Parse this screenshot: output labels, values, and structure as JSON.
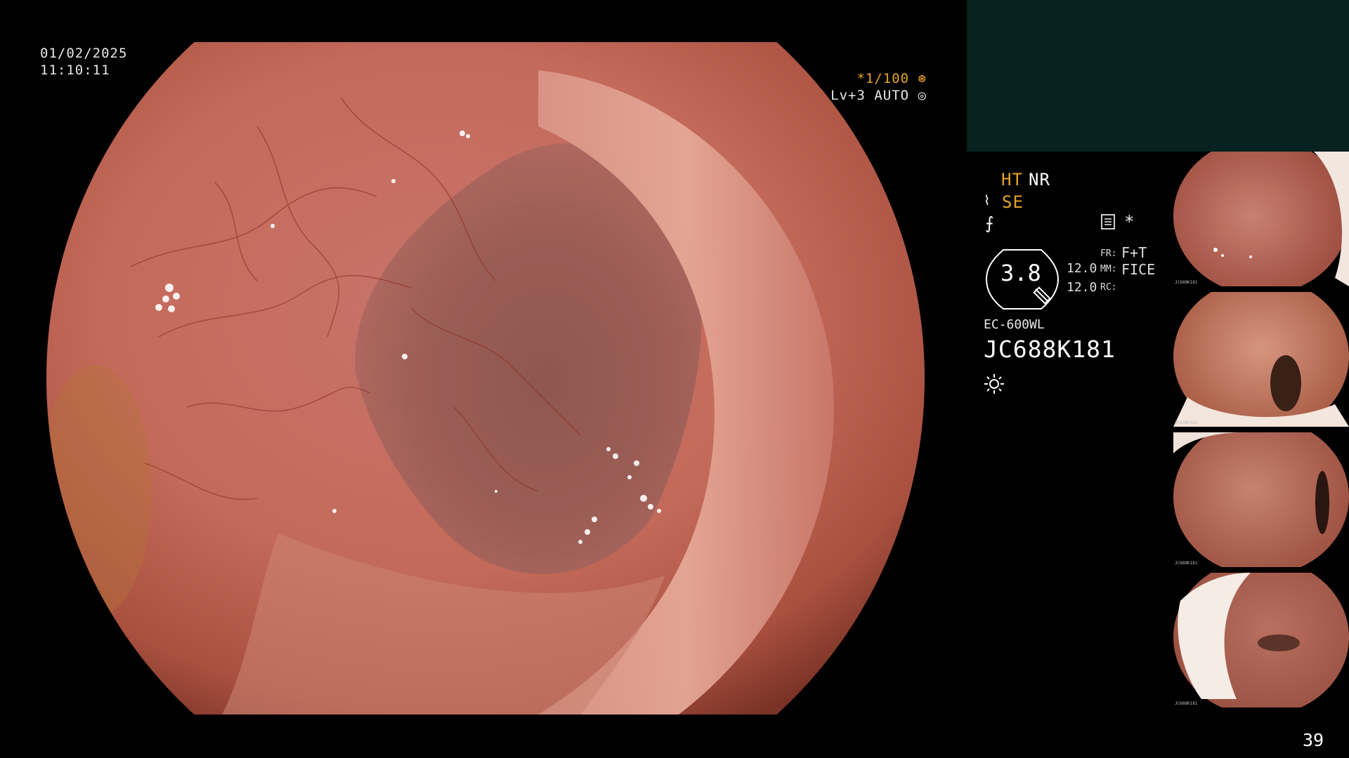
{
  "overlay": {
    "date": "01/02/2025",
    "time": "11:10:11",
    "shutter": "*1/100",
    "level": "Lv+3 AUTO"
  },
  "status": {
    "ht": "HT",
    "nr": "NR",
    "se": "SE",
    "zoom": "3.8",
    "value_top": "12.0",
    "value_bottom": "12.0",
    "fr_label": "FR:",
    "fr_value": "F+T",
    "mm_label": "MM:",
    "mm_value": "FICE",
    "rc_label": "RC:",
    "scope_model": "EC-600WL",
    "serial": "JC688K181"
  },
  "icons": {
    "shutter_icon": "aperture-icon",
    "level_icon": "target-icon",
    "enhance_icon": "enhance-icon",
    "curve_icon": "curve-icon",
    "doc_icon": "document-icon",
    "star_icon": "asterisk-icon",
    "light_icon": "light-icon"
  },
  "thumbnails": [
    {
      "caption": "JC688K181"
    },
    {
      "caption": "JC688K181"
    },
    {
      "caption": "JC688K181"
    },
    {
      "caption": "JC688K181"
    }
  ],
  "page_number": "39",
  "colors": {
    "accent_orange": "#e6a32a",
    "panel": "#072220"
  }
}
